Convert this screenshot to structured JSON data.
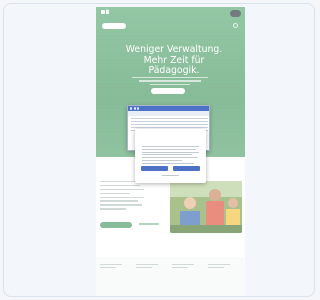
{
  "site": {
    "logo_text": "█ ",
    "topbar": {
      "pill_label": "",
      "avatar_name": ""
    },
    "hero": {
      "title": "Weniger Verwaltung. Mehr Zeit für Pädagogik.",
      "cta_label": ""
    },
    "section": {
      "title": "",
      "primary_button": "",
      "secondary_link": ""
    },
    "stats": [
      {
        "value": ""
      },
      {
        "value": ""
      },
      {
        "value": ""
      },
      {
        "value": ""
      }
    ]
  },
  "dialog": {
    "brand": "",
    "title": "",
    "accept_label": "",
    "settings_label": ""
  },
  "colors": {
    "brand_green": "#4d9b67",
    "dialog_blue": "#4c72c7",
    "text_dark": "#2f3b43"
  },
  "icons": [
    "logo-mark",
    "user-avatar",
    "menu-icon",
    "photo-kids"
  ]
}
